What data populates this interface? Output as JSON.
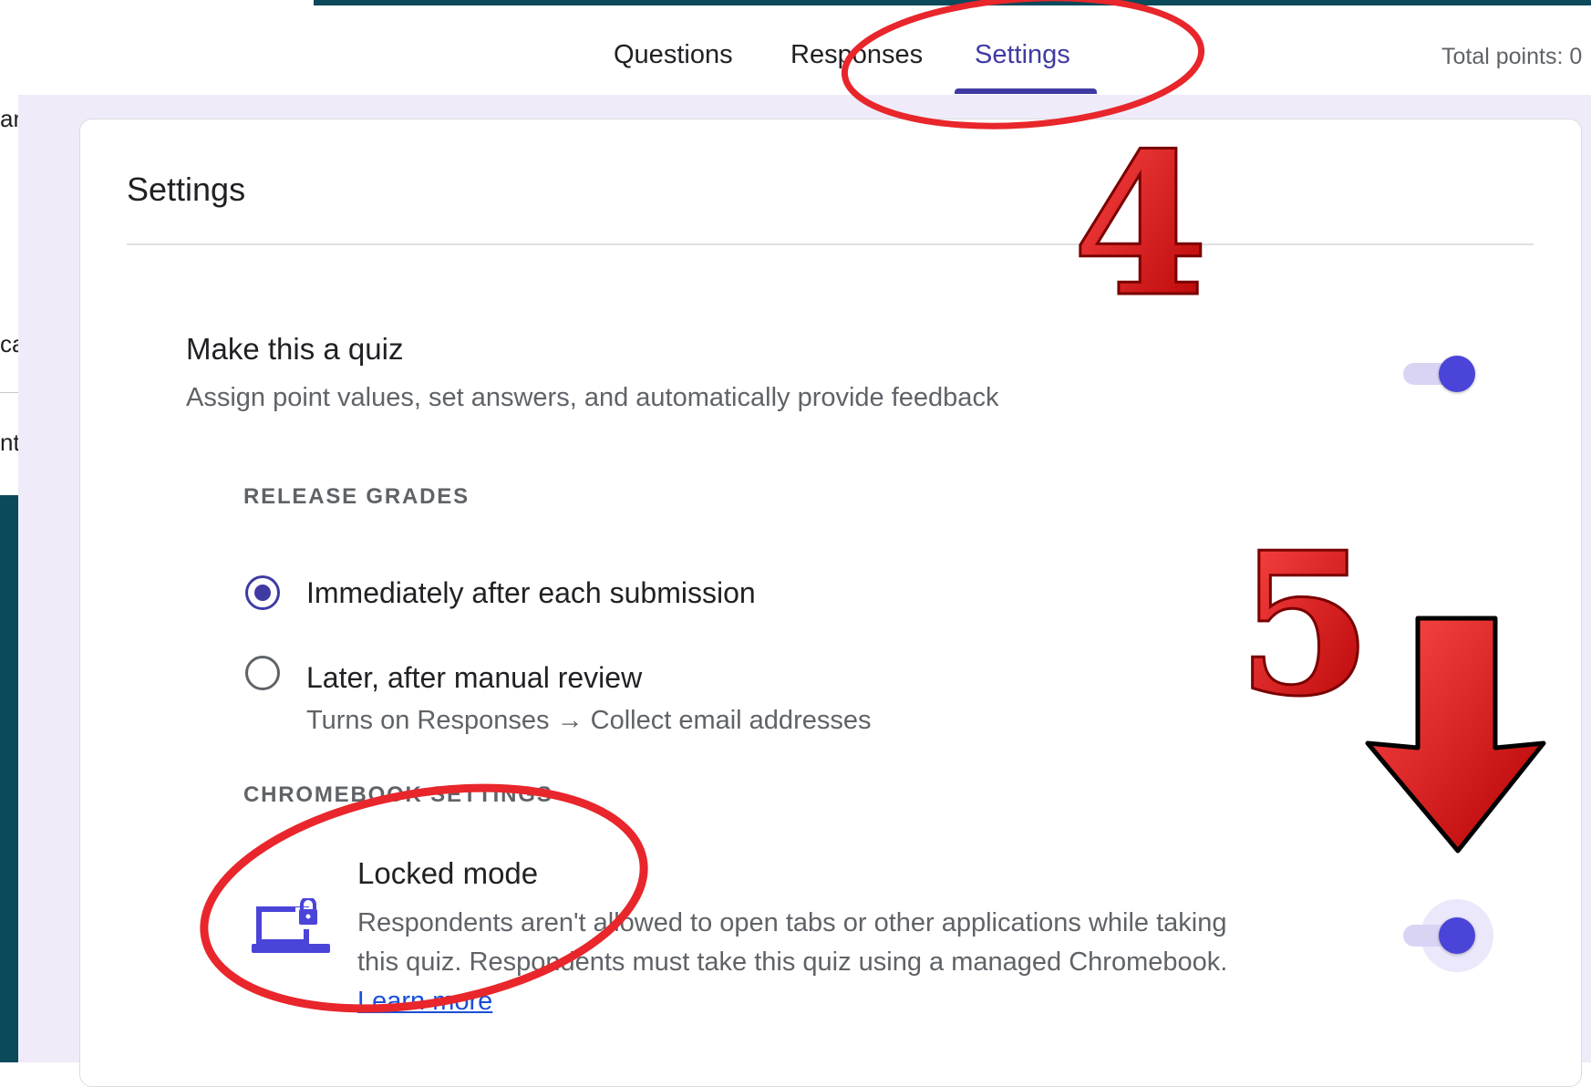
{
  "tabs": {
    "questions": "Questions",
    "responses": "Responses",
    "settings": "Settings",
    "total_points": "Total points: 0"
  },
  "left_fragments": [
    "an",
    "ca",
    "nt"
  ],
  "settings": {
    "title": "Settings",
    "quiz": {
      "title": "Make this a quiz",
      "description": "Assign point values, set answers, and automatically provide feedback",
      "enabled": true
    },
    "release_grades": {
      "label": "RELEASE GRADES",
      "options": [
        {
          "label": "Immediately after each submission",
          "selected": true
        },
        {
          "label": "Later, after manual review",
          "selected": false,
          "sub": "Turns on Responses → Collect email addresses"
        }
      ]
    },
    "chromebook": {
      "label": "CHROMEBOOK SETTINGS",
      "locked_mode": {
        "title": "Locked mode",
        "description": "Respondents aren't allowed to open tabs or other applications while taking this quiz. Respondents must take this quiz using a managed Chromebook.",
        "link": "Learn more",
        "enabled": true
      }
    }
  },
  "annotations": {
    "step_4": "4",
    "step_5": "5"
  },
  "colors": {
    "accent": "#3f3ba3",
    "toggle_knob": "#4a44d8",
    "teal_bar": "#0b4a5a",
    "annotation_red": "#e8262b"
  }
}
